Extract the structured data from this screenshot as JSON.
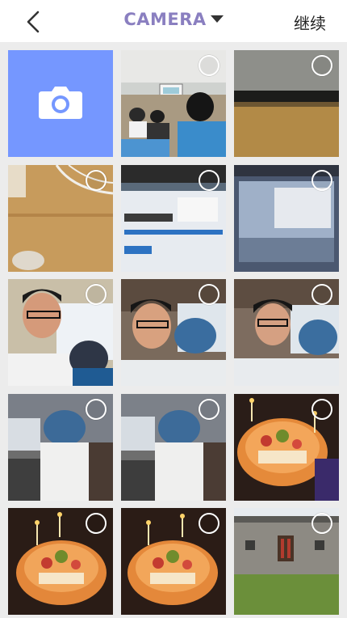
{
  "header": {
    "album_label": "CAMERA",
    "continue_label": "继续"
  },
  "icons": {
    "back": "chevron-left-icon",
    "dropdown": "caret-down-icon",
    "camera": "camera-icon",
    "select": "select-circle-icon"
  },
  "colors": {
    "album_label": "#8a7fc0",
    "camera_tile": "#7597ff"
  },
  "grid": {
    "columns": 3,
    "camera_tile": true,
    "photo_count": 14
  }
}
